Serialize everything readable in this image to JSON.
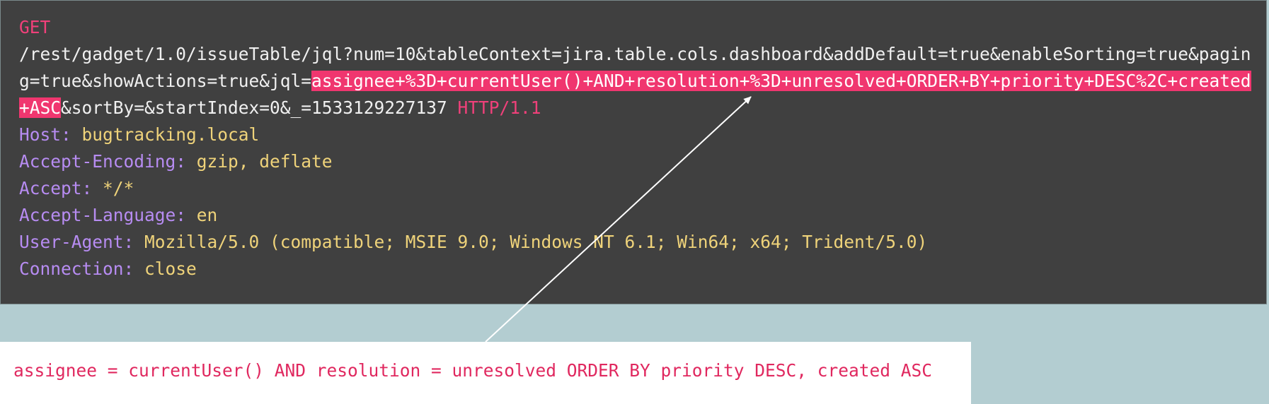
{
  "request": {
    "method": "GET",
    "url_before": "/rest/gadget/1.0/issueTable/jql?num=10&tableContext=jira.table.cols.dashboard&addDefault=true&enableSorting=true&paging=true&showActions=true&jql=",
    "url_highlight": "assignee+%3D+currentUser()+AND+resolution+%3D+unresolved+ORDER+BY+priority+DESC%2C+created+ASC",
    "url_after": "&sortBy=&startIndex=0&_=1533129227137 ",
    "protocol": "HTTP/1.1",
    "headers": [
      {
        "name": "Host:",
        "value": "bugtracking.local"
      },
      {
        "name": "Accept-Encoding:",
        "value": "gzip, deflate"
      },
      {
        "name": "Accept:",
        "value": "*/*"
      },
      {
        "name": "Accept-Language:",
        "value": "en"
      },
      {
        "name": "User-Agent:",
        "value": "Mozilla/5.0 (compatible; MSIE 9.0; Windows NT 6.1; Win64; x64; Trident/5.0)"
      },
      {
        "name": "Connection:",
        "value": "close"
      }
    ]
  },
  "decoded": {
    "text": "assignee = currentUser() AND resolution = unresolved ORDER BY priority DESC, created ASC"
  },
  "colors": {
    "panel_bg": "#404040",
    "page_bg": "#b3cdd1",
    "accent_pink": "#f0366f",
    "header_name": "#b78cf2",
    "header_value": "#efd37a"
  }
}
